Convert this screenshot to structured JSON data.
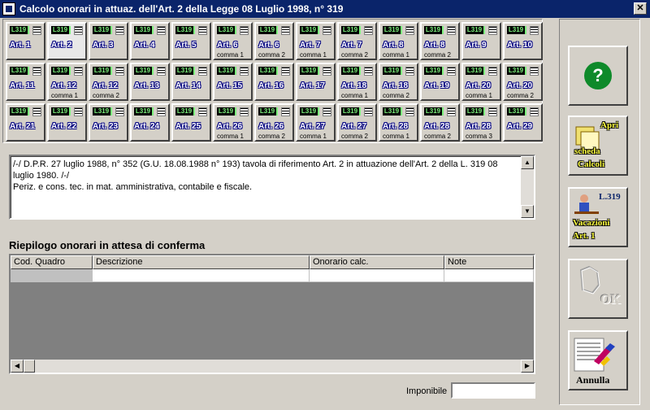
{
  "window": {
    "title": "Calcolo onorari in attuaz. dell'Art. 2 della Legge 08 Luglio 1998, n° 319",
    "close_label": "✕"
  },
  "articles": [
    {
      "label": "Art. 1",
      "sub": ""
    },
    {
      "label": "Art. 2",
      "sub": ""
    },
    {
      "label": "Art. 3",
      "sub": ""
    },
    {
      "label": "Art. 4",
      "sub": ""
    },
    {
      "label": "Art. 5",
      "sub": ""
    },
    {
      "label": "Art. 6",
      "sub": "comma 1"
    },
    {
      "label": "Art. 6",
      "sub": "comma 2"
    },
    {
      "label": "Art. 7",
      "sub": "comma 1"
    },
    {
      "label": "Art. 7",
      "sub": "comma 2"
    },
    {
      "label": "Art. 8",
      "sub": "comma 1"
    },
    {
      "label": "Art. 8",
      "sub": "comma 2"
    },
    {
      "label": "Art. 9",
      "sub": ""
    },
    {
      "label": "Art. 10",
      "sub": ""
    },
    {
      "label": "Art. 11",
      "sub": ""
    },
    {
      "label": "Art. 12",
      "sub": "comma 1"
    },
    {
      "label": "Art. 12",
      "sub": "comma 2"
    },
    {
      "label": "Art. 13",
      "sub": ""
    },
    {
      "label": "Art. 14",
      "sub": ""
    },
    {
      "label": "Art. 15",
      "sub": ""
    },
    {
      "label": "Art. 16",
      "sub": ""
    },
    {
      "label": "Art. 17",
      "sub": ""
    },
    {
      "label": "Art. 18",
      "sub": "comma 1"
    },
    {
      "label": "Art. 18",
      "sub": "comma 2"
    },
    {
      "label": "Art. 19",
      "sub": ""
    },
    {
      "label": "Art. 20",
      "sub": "comma 1"
    },
    {
      "label": "Art. 20",
      "sub": "comma 2"
    },
    {
      "label": "Art. 21",
      "sub": ""
    },
    {
      "label": "Art. 22",
      "sub": ""
    },
    {
      "label": "Art. 23",
      "sub": ""
    },
    {
      "label": "Art. 24",
      "sub": ""
    },
    {
      "label": "Art. 25",
      "sub": ""
    },
    {
      "label": "Art. 26",
      "sub": "comma 1"
    },
    {
      "label": "Art. 26",
      "sub": "comma 2"
    },
    {
      "label": "Art. 27",
      "sub": "comma 1"
    },
    {
      "label": "Art. 27",
      "sub": "comma 2"
    },
    {
      "label": "Art. 28",
      "sub": "comma 1"
    },
    {
      "label": "Art. 28",
      "sub": "comma 2"
    },
    {
      "label": "Art. 28",
      "sub": "comma 3"
    },
    {
      "label": "Art. 29",
      "sub": ""
    }
  ],
  "article_logo": "L319",
  "selected_article": "Art. 2",
  "description": {
    "line1": "/-/ D.P.R. 27 luglio 1988, n° 352 (G.U. 18.08.1988 n° 193) tavola di riferimento Art. 2 in attuazione dell'Art. 2 della L. 319  08 luglio 1980. /-/",
    "line2": "Periz. e cons. tec. in mat. amministrativa, contabile e fiscale."
  },
  "summary": {
    "title": "Riepilogo onorari in attesa di conferma",
    "columns": [
      "Cod. Quadro",
      "Descrizione",
      "Onorario calc.",
      "Note"
    ]
  },
  "imponibile": {
    "label": "Imponibile",
    "value": ""
  },
  "buttons": {
    "help": "?",
    "apri": {
      "l1": "Apri",
      "l2": "scheda",
      "l3": "Calcoli"
    },
    "vacazioni": {
      "l1": "L.319",
      "l2": "Vacazioni",
      "l3": "Art. 1"
    },
    "ok": "OK",
    "annulla": "Annulla"
  },
  "colors": {
    "titlebar": "#0a246a",
    "window": "#d4d0c8",
    "logo_green": "#7df07d",
    "help_green": "#0e8a2a"
  }
}
